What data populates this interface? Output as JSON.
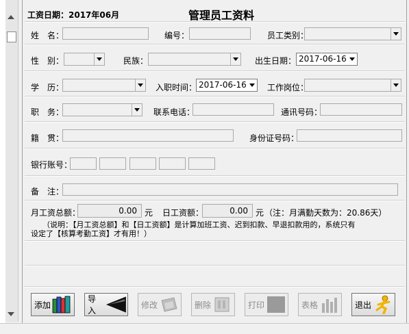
{
  "header": {
    "date_label": "工资日期：2017年06月",
    "title": "管理员工资料"
  },
  "form": {
    "name_label": "姓　名：",
    "id_label": "编号：",
    "category_label": "员工类别：",
    "gender_label": "性　别：",
    "ethnicity_label": "民族：",
    "birthdate_label": "出生日期：",
    "birthdate_value": "2017-06-16",
    "education_label": "学　历：",
    "hire_date_label": "入职时间：",
    "hire_date_value": "2017-06-16",
    "position_label": "工作岗位：",
    "job_title_label": "职　务：",
    "phone_label": "联系电话：",
    "comm_label": "通讯号码：",
    "origin_label": "籍　贯：",
    "id_card_label": "身份证号码：",
    "bank_label": "银行账号：",
    "remark_label": "备　注："
  },
  "salary": {
    "monthly_label": "月工资总额：",
    "monthly_value": "0.00",
    "unit1": "元",
    "daily_label": "日工资额：",
    "daily_value": "0.00",
    "unit2": "元",
    "note": "（注：月满勤天数为：20.86天）",
    "explain_line1": "（说明：【月工资总额】和【日工资额】是计算加班工资、迟到扣款、早退扣款用的，系统只有",
    "explain_line2": "设定了【核算考勤工资】才有用！）"
  },
  "buttons": {
    "add": "添加",
    "import": "导入",
    "edit": "修改",
    "delete": "删除",
    "print": "打印",
    "table": "表格",
    "exit": "退出"
  },
  "icons": {
    "add": "books-icon",
    "import": "arrow-left-icon",
    "edit": "edit-icon",
    "delete": "delete-icon",
    "print": "printer-icon",
    "table": "bar-chart-icon",
    "exit": "running-man-icon"
  }
}
